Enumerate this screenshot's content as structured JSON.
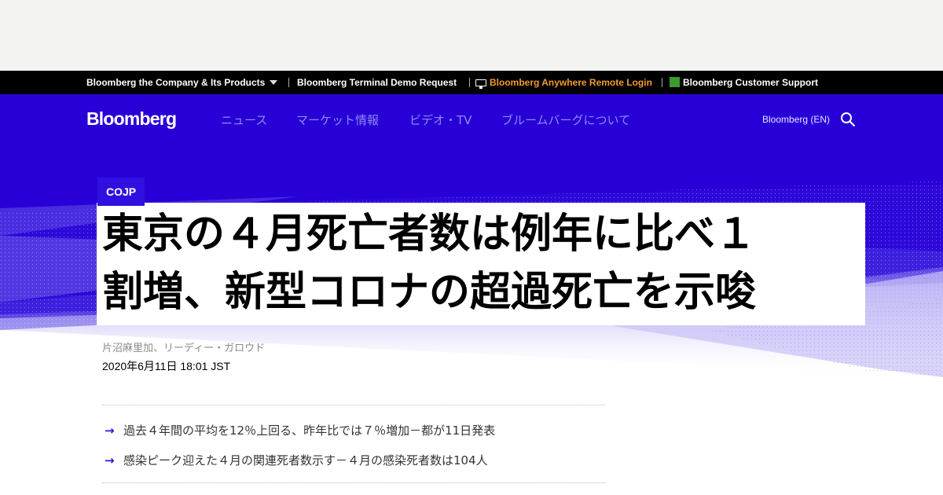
{
  "utility_bar": {
    "company": "Bloomberg the Company & Its Products",
    "terminal_demo": "Bloomberg Terminal Demo Request",
    "anywhere_login": "Bloomberg Anywhere Remote Login",
    "customer_support": "Bloomberg Customer Support"
  },
  "header": {
    "logo": "Bloomberg",
    "nav": [
      "ニュース",
      "マーケット情報",
      "ビデオ・TV",
      "ブルームバーグについて"
    ],
    "edition": "Bloomberg (EN)",
    "search_icon": "search-icon"
  },
  "article": {
    "section": "COJP",
    "headline_lines": [
      "東京の４月死亡者数は例年に比べ１",
      "割増、新型コロナの超過死亡を示唆"
    ],
    "byline": "片沼麻里加、リーディー・ガロウド",
    "date": "2020年6月11日 18:01 JST",
    "abstract": [
      "過去４年間の平均を12％上回る、昨年比では７％増加－都が11日発表",
      "感染ピーク迎えた４月の関連死者数示す－４月の感染死者数は104人"
    ]
  },
  "colors": {
    "brand_blue": "#2800d7",
    "anywhere_orange": "#f39c2e",
    "support_green": "#3c9a2e",
    "nav_text": "#8c8cf2"
  }
}
